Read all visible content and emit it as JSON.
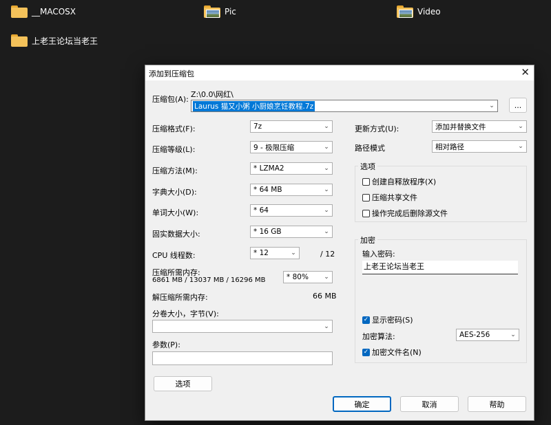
{
  "desktop": {
    "items": [
      {
        "label": "__MACOSX"
      },
      {
        "label": "Pic"
      },
      {
        "label": "Video"
      },
      {
        "label": "上老王论坛当老王"
      }
    ]
  },
  "dialog": {
    "title": "添加到压缩包",
    "archive": {
      "label": "压缩包(A):",
      "path": "Z:\\0.0\\网红\\",
      "filename": "Laurus 猫又小粥 小厨娘烹饪教程.7z",
      "browse_label": "..."
    },
    "left": {
      "format": {
        "label": "压缩格式(F):",
        "value": "7z"
      },
      "level": {
        "label": "压缩等级(L):",
        "value": "9 - 极限压缩"
      },
      "method": {
        "label": "压缩方法(M):",
        "value": "* LZMA2"
      },
      "dict": {
        "label": "字典大小(D):",
        "value": "* 64 MB"
      },
      "word": {
        "label": "单词大小(W):",
        "value": "* 64"
      },
      "solid": {
        "label": "固实数据大小:",
        "value": "* 16 GB"
      },
      "cpu": {
        "label": "CPU 线程数:",
        "value": "* 12",
        "total": "/ 12"
      },
      "mem_compress": {
        "label": "压缩所需内存:",
        "detail": "6861 MB / 13037 MB / 16296 MB",
        "value": "* 80%"
      },
      "mem_decompress": {
        "label": "解压缩所需内存:",
        "value": "66 MB"
      },
      "volume": {
        "label": "分卷大小，字节(V):",
        "value": ""
      },
      "params": {
        "label": "参数(P):",
        "value": ""
      },
      "options_button": "选项"
    },
    "right": {
      "update": {
        "label": "更新方式(U):",
        "value": "添加并替换文件"
      },
      "pathmode": {
        "label": "路径模式",
        "value": "相对路径"
      },
      "options_group": {
        "title": "选项",
        "sfx": {
          "label": "创建自释放程序(X)",
          "checked": false
        },
        "shared": {
          "label": "压缩共享文件",
          "checked": false
        },
        "delete": {
          "label": "操作完成后删除源文件",
          "checked": false
        }
      },
      "encrypt_group": {
        "title": "加密",
        "pwd_label": "输入密码:",
        "pwd_value": "上老王论坛当老王",
        "show_pwd": {
          "label": "显示密码(S)",
          "checked": true
        },
        "algo_label": "加密算法:",
        "algo_value": "AES-256",
        "encrypt_names": {
          "label": "加密文件名(N)",
          "checked": true
        }
      }
    },
    "buttons": {
      "ok": "确定",
      "cancel": "取消",
      "help": "帮助"
    }
  },
  "colors": {
    "accent": "#0067c0",
    "selection": "#0078d7",
    "folder": "#f4c25a"
  }
}
